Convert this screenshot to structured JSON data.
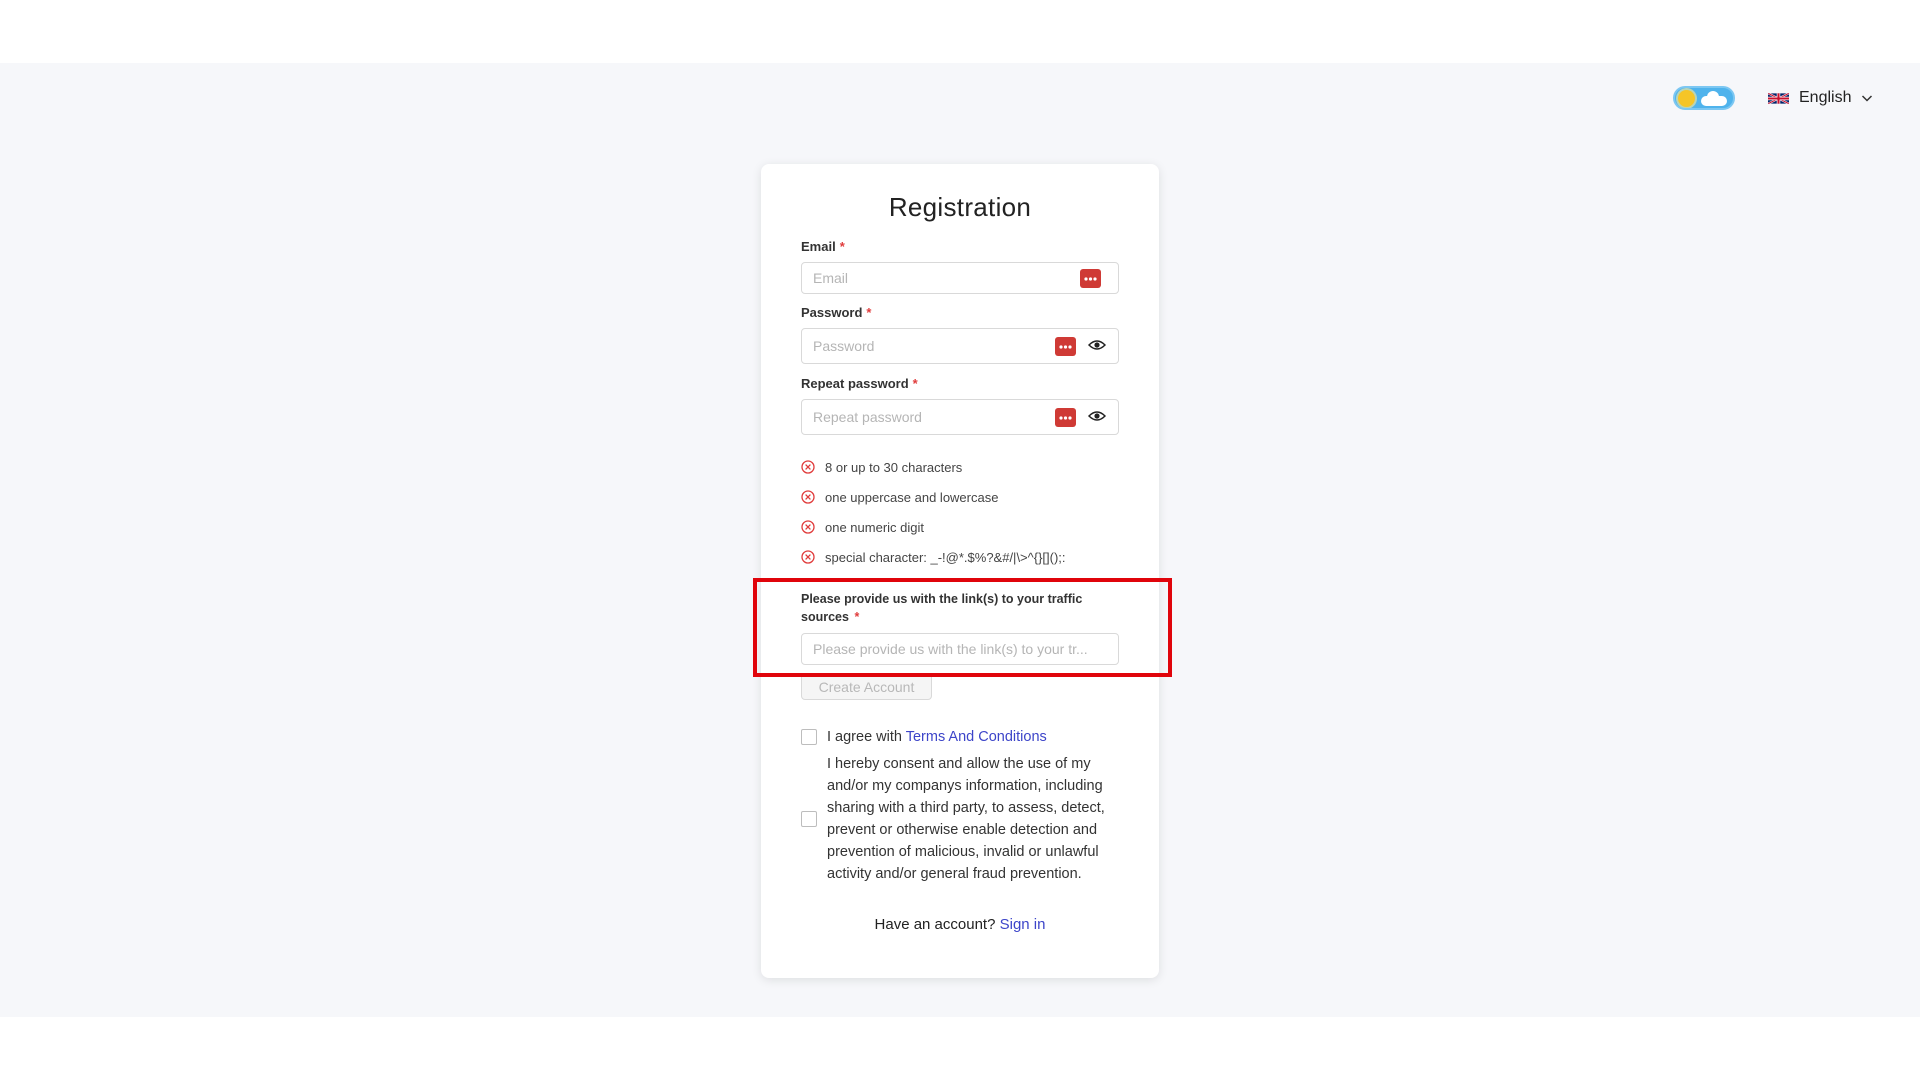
{
  "header": {
    "language": "English",
    "theme_toggle_state": "light",
    "flag_icon": "uk-flag-icon"
  },
  "form": {
    "title": "Registration",
    "email": {
      "label": "Email",
      "required_mark": "*",
      "placeholder": "Email",
      "value": ""
    },
    "password": {
      "label": "Password",
      "required_mark": "*",
      "placeholder": "Password",
      "value": ""
    },
    "repeat_password": {
      "label": "Repeat password",
      "required_mark": "*",
      "placeholder": "Repeat password",
      "value": ""
    },
    "rules": [
      {
        "text": "8 or up to 30 characters",
        "status": "unmet"
      },
      {
        "text": "one uppercase and lowercase",
        "status": "unmet"
      },
      {
        "text": "one numeric digit",
        "status": "unmet"
      },
      {
        "text": "special character: _-!@*.$%?&#/|\\>^{}[]();:",
        "status": "unmet"
      }
    ],
    "traffic": {
      "label": "Please provide us with the link(s) to your traffic sources",
      "required_mark": "*",
      "placeholder": "Please provide us with the link(s) to your tr...",
      "value": ""
    },
    "create_button": "Create Account",
    "agree": {
      "prefix": "I agree with ",
      "link": "Terms And Conditions",
      "checked": false
    },
    "consent": {
      "text": "I hereby consent and allow the use of my and/or my companys information, including sharing with a third party, to assess, detect, prevent or otherwise enable detection and prevention of malicious, invalid or unlawful activity and/or general fraud prevention.",
      "checked": false
    },
    "signin": {
      "prefix": "Have an account?",
      "link": "Sign in"
    }
  },
  "colors": {
    "accent_link": "#3d45c9",
    "error": "#e03b3b",
    "highlight_box": "#e0040b",
    "password_manager_icon": "#cf3a35"
  }
}
